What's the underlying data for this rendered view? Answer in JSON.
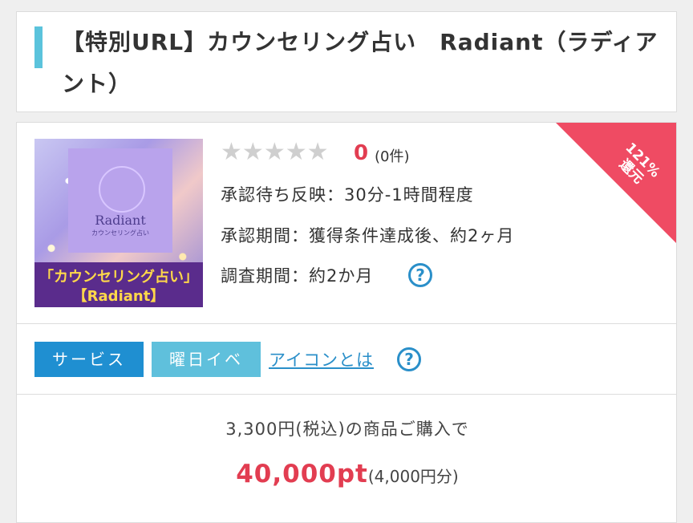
{
  "title": {
    "text": "【特別URL】カウンセリング占い　Radiant（ラディアント）",
    "accent_color": "#5bc3dc"
  },
  "thumbnail": {
    "brand": "Radiant",
    "brand_sub": "カウンセリング占い",
    "band_line1": "「カウンセリング占い」",
    "band_line2": "【Radiant】"
  },
  "rating": {
    "score": "0",
    "count_label": "(0件)",
    "stars": 5,
    "filled": 0
  },
  "info": {
    "approval_wait": "承認待ち反映：30分-1時間程度",
    "approval_period": "承認期間：獲得条件達成後、約2ヶ月",
    "survey_period": "調査期間：約2か月"
  },
  "ribbon": {
    "line1": "121%",
    "line2": "還元",
    "color": "#ef4b63"
  },
  "tags": {
    "service": "サービス",
    "event": "曜日イベ",
    "icon_link": "アイコンとは"
  },
  "purchase": {
    "condition": "3,300円(税込)の商品ご購入で",
    "points": "40,000pt",
    "yen": "(4,000円分)"
  },
  "colors": {
    "points": "#e23d51",
    "link": "#2a8fc9",
    "tag_service": "#1f8fd1",
    "tag_event": "#5fc0dc"
  }
}
